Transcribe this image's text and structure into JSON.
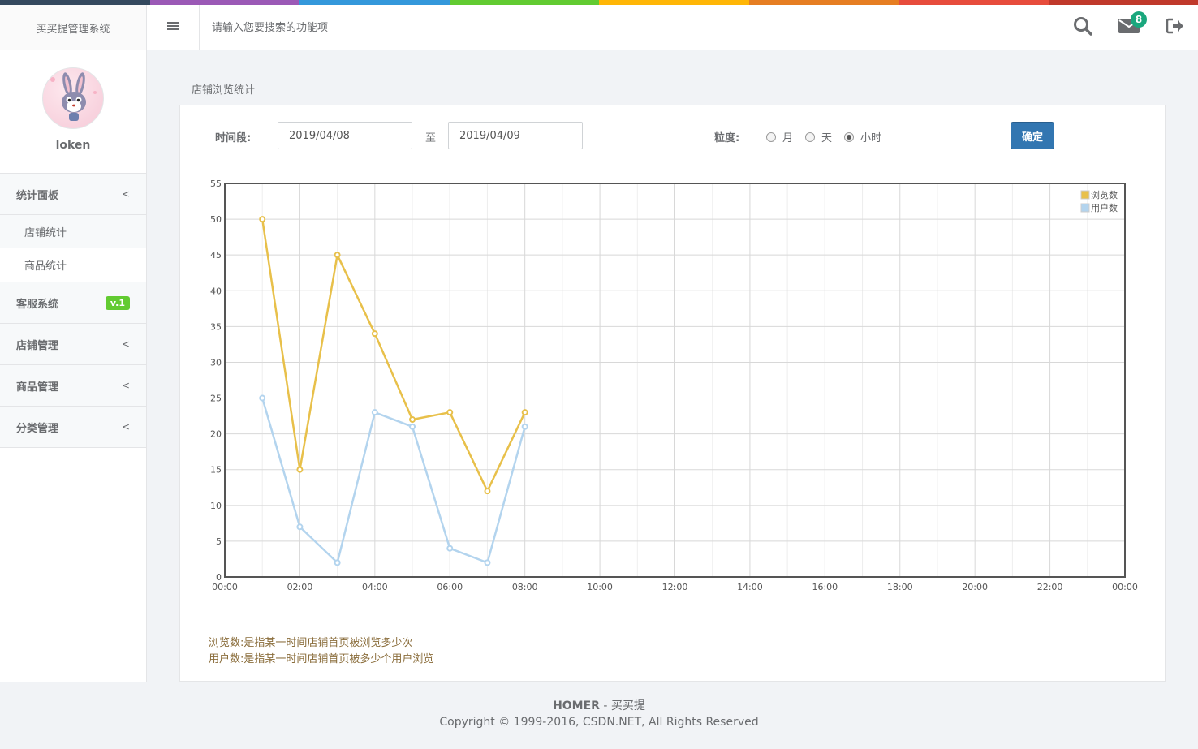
{
  "brand": {
    "title": "买买提管理系统"
  },
  "color_line": [
    "#34495e",
    "#9b59b6",
    "#3498db",
    "#62cb31",
    "#ffb606",
    "#e67e22",
    "#e74c3c",
    "#c0392b"
  ],
  "header": {
    "search_placeholder": "请输入您要搜索的功能项",
    "mail_count": "8",
    "icons": [
      "menu-icon",
      "search-icon",
      "envelope-icon",
      "logout-icon"
    ]
  },
  "profile": {
    "username": "loken"
  },
  "sidebar": {
    "stats_panel": "统计面板",
    "shop_stats": "店铺统计",
    "goods_stats": "商品统计",
    "customer_service": "客服系统",
    "customer_service_badge": "v.1",
    "shop_mgmt": "店铺管理",
    "goods_mgmt": "商品管理",
    "category_mgmt": "分类管理"
  },
  "main": {
    "title": "店铺浏览统计",
    "time_label": "时间段:",
    "start_date": "2019/04/08",
    "to_label": "至",
    "end_date": "2019/04/09",
    "granularity_label": "粒度:",
    "granularity_options": [
      "月",
      "天",
      "小时"
    ],
    "granularity_selected": "小时",
    "confirm_label": "确定",
    "note_views": "浏览数:是指某一时间店铺首页被浏览多少次",
    "note_users": "用户数:是指某一时间店铺首页被多少个用户浏览"
  },
  "chart_data": {
    "type": "line",
    "x_ticks": [
      "00:00",
      "02:00",
      "04:00",
      "06:00",
      "08:00",
      "10:00",
      "12:00",
      "14:00",
      "16:00",
      "18:00",
      "20:00",
      "22:00",
      "00:00"
    ],
    "xlim_hours": [
      0,
      24
    ],
    "ylim": [
      0,
      55
    ],
    "y_ticks": [
      0,
      5,
      10,
      15,
      20,
      25,
      30,
      35,
      40,
      45,
      50,
      55
    ],
    "grid": true,
    "legend_position": "top-right",
    "series": [
      {
        "name": "浏览数",
        "color": "#e8c04a",
        "x": [
          1,
          2,
          3,
          4,
          5,
          6,
          7,
          8
        ],
        "values": [
          50,
          15,
          45,
          34,
          22,
          23,
          12,
          23
        ]
      },
      {
        "name": "用户数",
        "color": "#b3d4ee",
        "x": [
          1,
          2,
          3,
          4,
          5,
          6,
          7,
          8
        ],
        "values": [
          25,
          7,
          2,
          23,
          21,
          4,
          2,
          21
        ]
      }
    ]
  },
  "footer": {
    "brand": "HOMER",
    "brand_suffix": " - 买买提",
    "copyright": "Copyright © 1999-2016, CSDN.NET, All Rights Reserved"
  }
}
